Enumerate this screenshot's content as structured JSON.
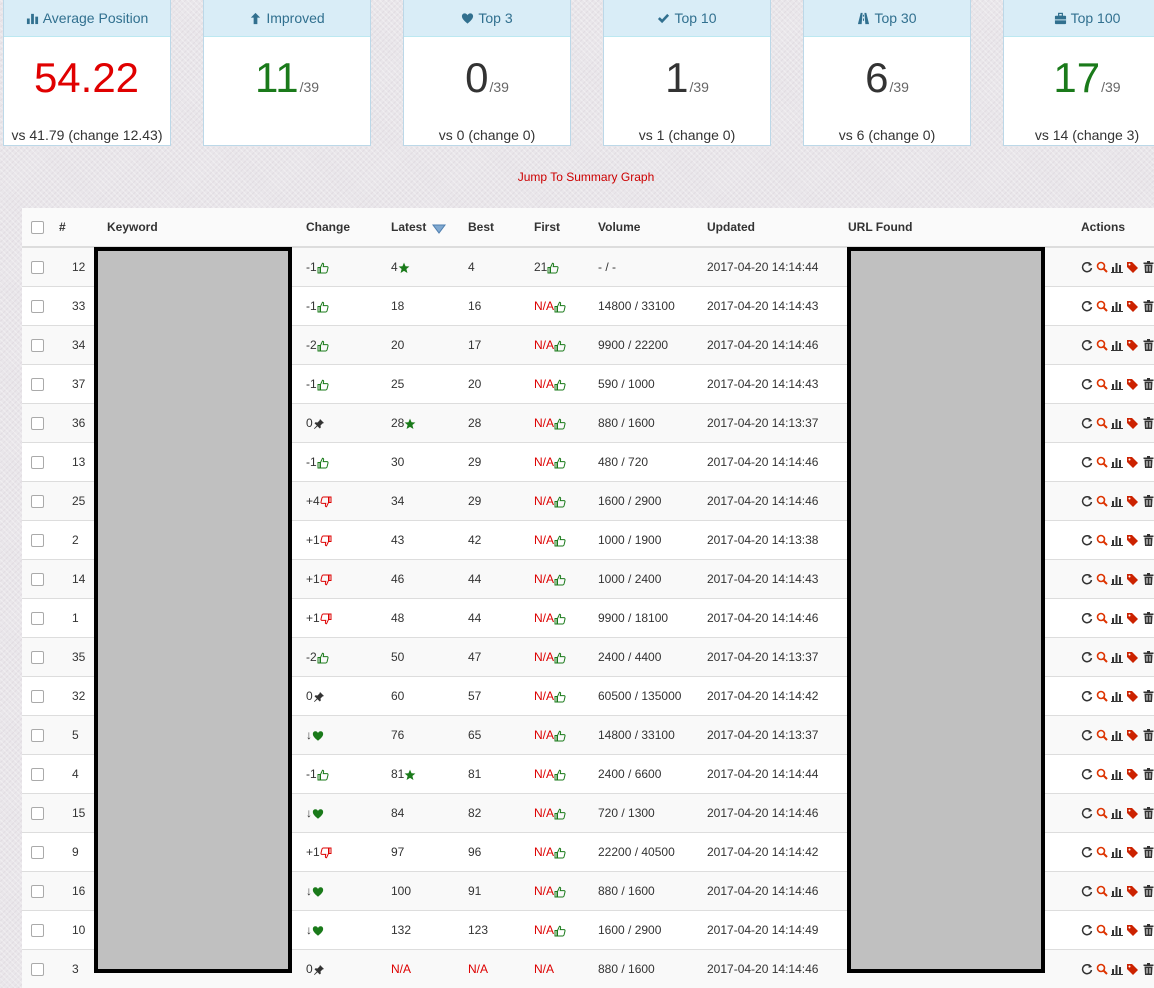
{
  "cards": [
    {
      "title": "Average Position",
      "icon": "bar-chart-icon",
      "value": "54.22",
      "denominator": "",
      "value_color": "#e00000",
      "footer": "vs 41.79 (change 12.43)"
    },
    {
      "title": "Improved",
      "icon": "arrow-up-icon",
      "value": "11",
      "denominator": "/39",
      "value_color": "#1a7a1a",
      "footer": ""
    },
    {
      "title": "Top 3",
      "icon": "heart-icon",
      "value": "0",
      "denominator": "/39",
      "value_color": "#333333",
      "footer": "vs 0 (change 0)"
    },
    {
      "title": "Top 10",
      "icon": "checkmark-icon",
      "value": "1",
      "denominator": "/39",
      "value_color": "#333333",
      "footer": "vs 1 (change 0)"
    },
    {
      "title": "Top 30",
      "icon": "road-icon",
      "value": "6",
      "denominator": "/39",
      "value_color": "#333333",
      "footer": "vs 6 (change 0)"
    },
    {
      "title": "Top 100",
      "icon": "briefcase-icon",
      "value": "17",
      "denominator": "/39",
      "value_color": "#1a7a1a",
      "footer": "vs 14 (change 3)"
    }
  ],
  "jump_link": "Jump To Summary Graph",
  "table": {
    "headers": {
      "id": "#",
      "keyword": "Keyword",
      "change": "Change",
      "latest": "Latest",
      "best": "Best",
      "first": "First",
      "volume": "Volume",
      "updated": "Updated",
      "url": "URL Found",
      "actions": "Actions"
    },
    "rows": [
      {
        "id": "12",
        "change": "-1",
        "change_icon": "thumbs-up",
        "latest": "4",
        "latest_star": true,
        "best": "4",
        "first": "21",
        "first_icon": "thumbs-up",
        "volume": "- / -",
        "updated": "2017-04-20 14:14:44"
      },
      {
        "id": "33",
        "change": "-1",
        "change_icon": "thumbs-up",
        "latest": "18",
        "latest_star": false,
        "best": "16",
        "first": "N/A",
        "first_icon": "thumbs-up",
        "volume": "14800 / 33100",
        "updated": "2017-04-20 14:14:43"
      },
      {
        "id": "34",
        "change": "-2",
        "change_icon": "thumbs-up",
        "latest": "20",
        "latest_star": false,
        "best": "17",
        "first": "N/A",
        "first_icon": "thumbs-up",
        "volume": "9900 / 22200",
        "updated": "2017-04-20 14:14:46"
      },
      {
        "id": "37",
        "change": "-1",
        "change_icon": "thumbs-up",
        "latest": "25",
        "latest_star": false,
        "best": "20",
        "first": "N/A",
        "first_icon": "thumbs-up",
        "volume": "590 / 1000",
        "updated": "2017-04-20 14:14:43"
      },
      {
        "id": "36",
        "change": "0",
        "change_icon": "pin",
        "latest": "28",
        "latest_star": true,
        "best": "28",
        "first": "N/A",
        "first_icon": "thumbs-up",
        "volume": "880 / 1600",
        "updated": "2017-04-20 14:13:37"
      },
      {
        "id": "13",
        "change": "-1",
        "change_icon": "thumbs-up",
        "latest": "30",
        "latest_star": false,
        "best": "29",
        "first": "N/A",
        "first_icon": "thumbs-up",
        "volume": "480 / 720",
        "updated": "2017-04-20 14:14:46"
      },
      {
        "id": "25",
        "change": "+4",
        "change_icon": "thumbs-down",
        "latest": "34",
        "latest_star": false,
        "best": "29",
        "first": "N/A",
        "first_icon": "thumbs-up",
        "volume": "1600 / 2900",
        "updated": "2017-04-20 14:14:46"
      },
      {
        "id": "2",
        "change": "+1",
        "change_icon": "thumbs-down",
        "latest": "43",
        "latest_star": false,
        "best": "42",
        "first": "N/A",
        "first_icon": "thumbs-up",
        "volume": "1000 / 1900",
        "updated": "2017-04-20 14:13:38"
      },
      {
        "id": "14",
        "change": "+1",
        "change_icon": "thumbs-down",
        "latest": "46",
        "latest_star": false,
        "best": "44",
        "first": "N/A",
        "first_icon": "thumbs-up",
        "volume": "1000 / 2400",
        "updated": "2017-04-20 14:14:43"
      },
      {
        "id": "1",
        "change": "+1",
        "change_icon": "thumbs-down",
        "latest": "48",
        "latest_star": false,
        "best": "44",
        "first": "N/A",
        "first_icon": "thumbs-up",
        "volume": "9900 / 18100",
        "updated": "2017-04-20 14:14:46"
      },
      {
        "id": "35",
        "change": "-2",
        "change_icon": "thumbs-up",
        "latest": "50",
        "latest_star": false,
        "best": "47",
        "first": "N/A",
        "first_icon": "thumbs-up",
        "volume": "2400 / 4400",
        "updated": "2017-04-20 14:13:37"
      },
      {
        "id": "32",
        "change": "0",
        "change_icon": "pin",
        "latest": "60",
        "latest_star": false,
        "best": "57",
        "first": "N/A",
        "first_icon": "thumbs-up",
        "volume": "60500 / 135000",
        "updated": "2017-04-20 14:14:42"
      },
      {
        "id": "5",
        "change": "↓",
        "change_icon": "heart",
        "latest": "76",
        "latest_star": false,
        "best": "65",
        "first": "N/A",
        "first_icon": "thumbs-up",
        "volume": "14800 / 33100",
        "updated": "2017-04-20 14:13:37"
      },
      {
        "id": "4",
        "change": "-1",
        "change_icon": "thumbs-up",
        "latest": "81",
        "latest_star": true,
        "best": "81",
        "first": "N/A",
        "first_icon": "thumbs-up",
        "volume": "2400 / 6600",
        "updated": "2017-04-20 14:14:44"
      },
      {
        "id": "15",
        "change": "↓",
        "change_icon": "heart",
        "latest": "84",
        "latest_star": false,
        "best": "82",
        "first": "N/A",
        "first_icon": "thumbs-up",
        "volume": "720 / 1300",
        "updated": "2017-04-20 14:14:46"
      },
      {
        "id": "9",
        "change": "+1",
        "change_icon": "thumbs-down",
        "latest": "97",
        "latest_star": false,
        "best": "96",
        "first": "N/A",
        "first_icon": "thumbs-up",
        "volume": "22200 / 40500",
        "updated": "2017-04-20 14:14:42"
      },
      {
        "id": "16",
        "change": "↓",
        "change_icon": "heart",
        "latest": "100",
        "latest_star": false,
        "best": "91",
        "first": "N/A",
        "first_icon": "thumbs-up",
        "volume": "880 / 1600",
        "updated": "2017-04-20 14:14:46"
      },
      {
        "id": "10",
        "change": "↓",
        "change_icon": "heart",
        "latest": "132",
        "latest_star": false,
        "best": "123",
        "first": "N/A",
        "first_icon": "thumbs-up",
        "volume": "1600 / 2900",
        "updated": "2017-04-20 14:14:49"
      },
      {
        "id": "3",
        "change": "0",
        "change_icon": "pin",
        "latest": "N/A",
        "latest_star": false,
        "best": "N/A",
        "first": "N/A",
        "first_icon": "none",
        "volume": "880 / 1600",
        "updated": "2017-04-20 14:14:46"
      }
    ]
  },
  "colors": {
    "na": "#dd0000",
    "thumb_up": "#1a7a1a",
    "thumb_down": "#dd0000",
    "star": "#1a7a1a",
    "heart": "#1a7a1a",
    "refresh": "#333333",
    "search": "#dd3300",
    "tag": "#cc2200"
  }
}
